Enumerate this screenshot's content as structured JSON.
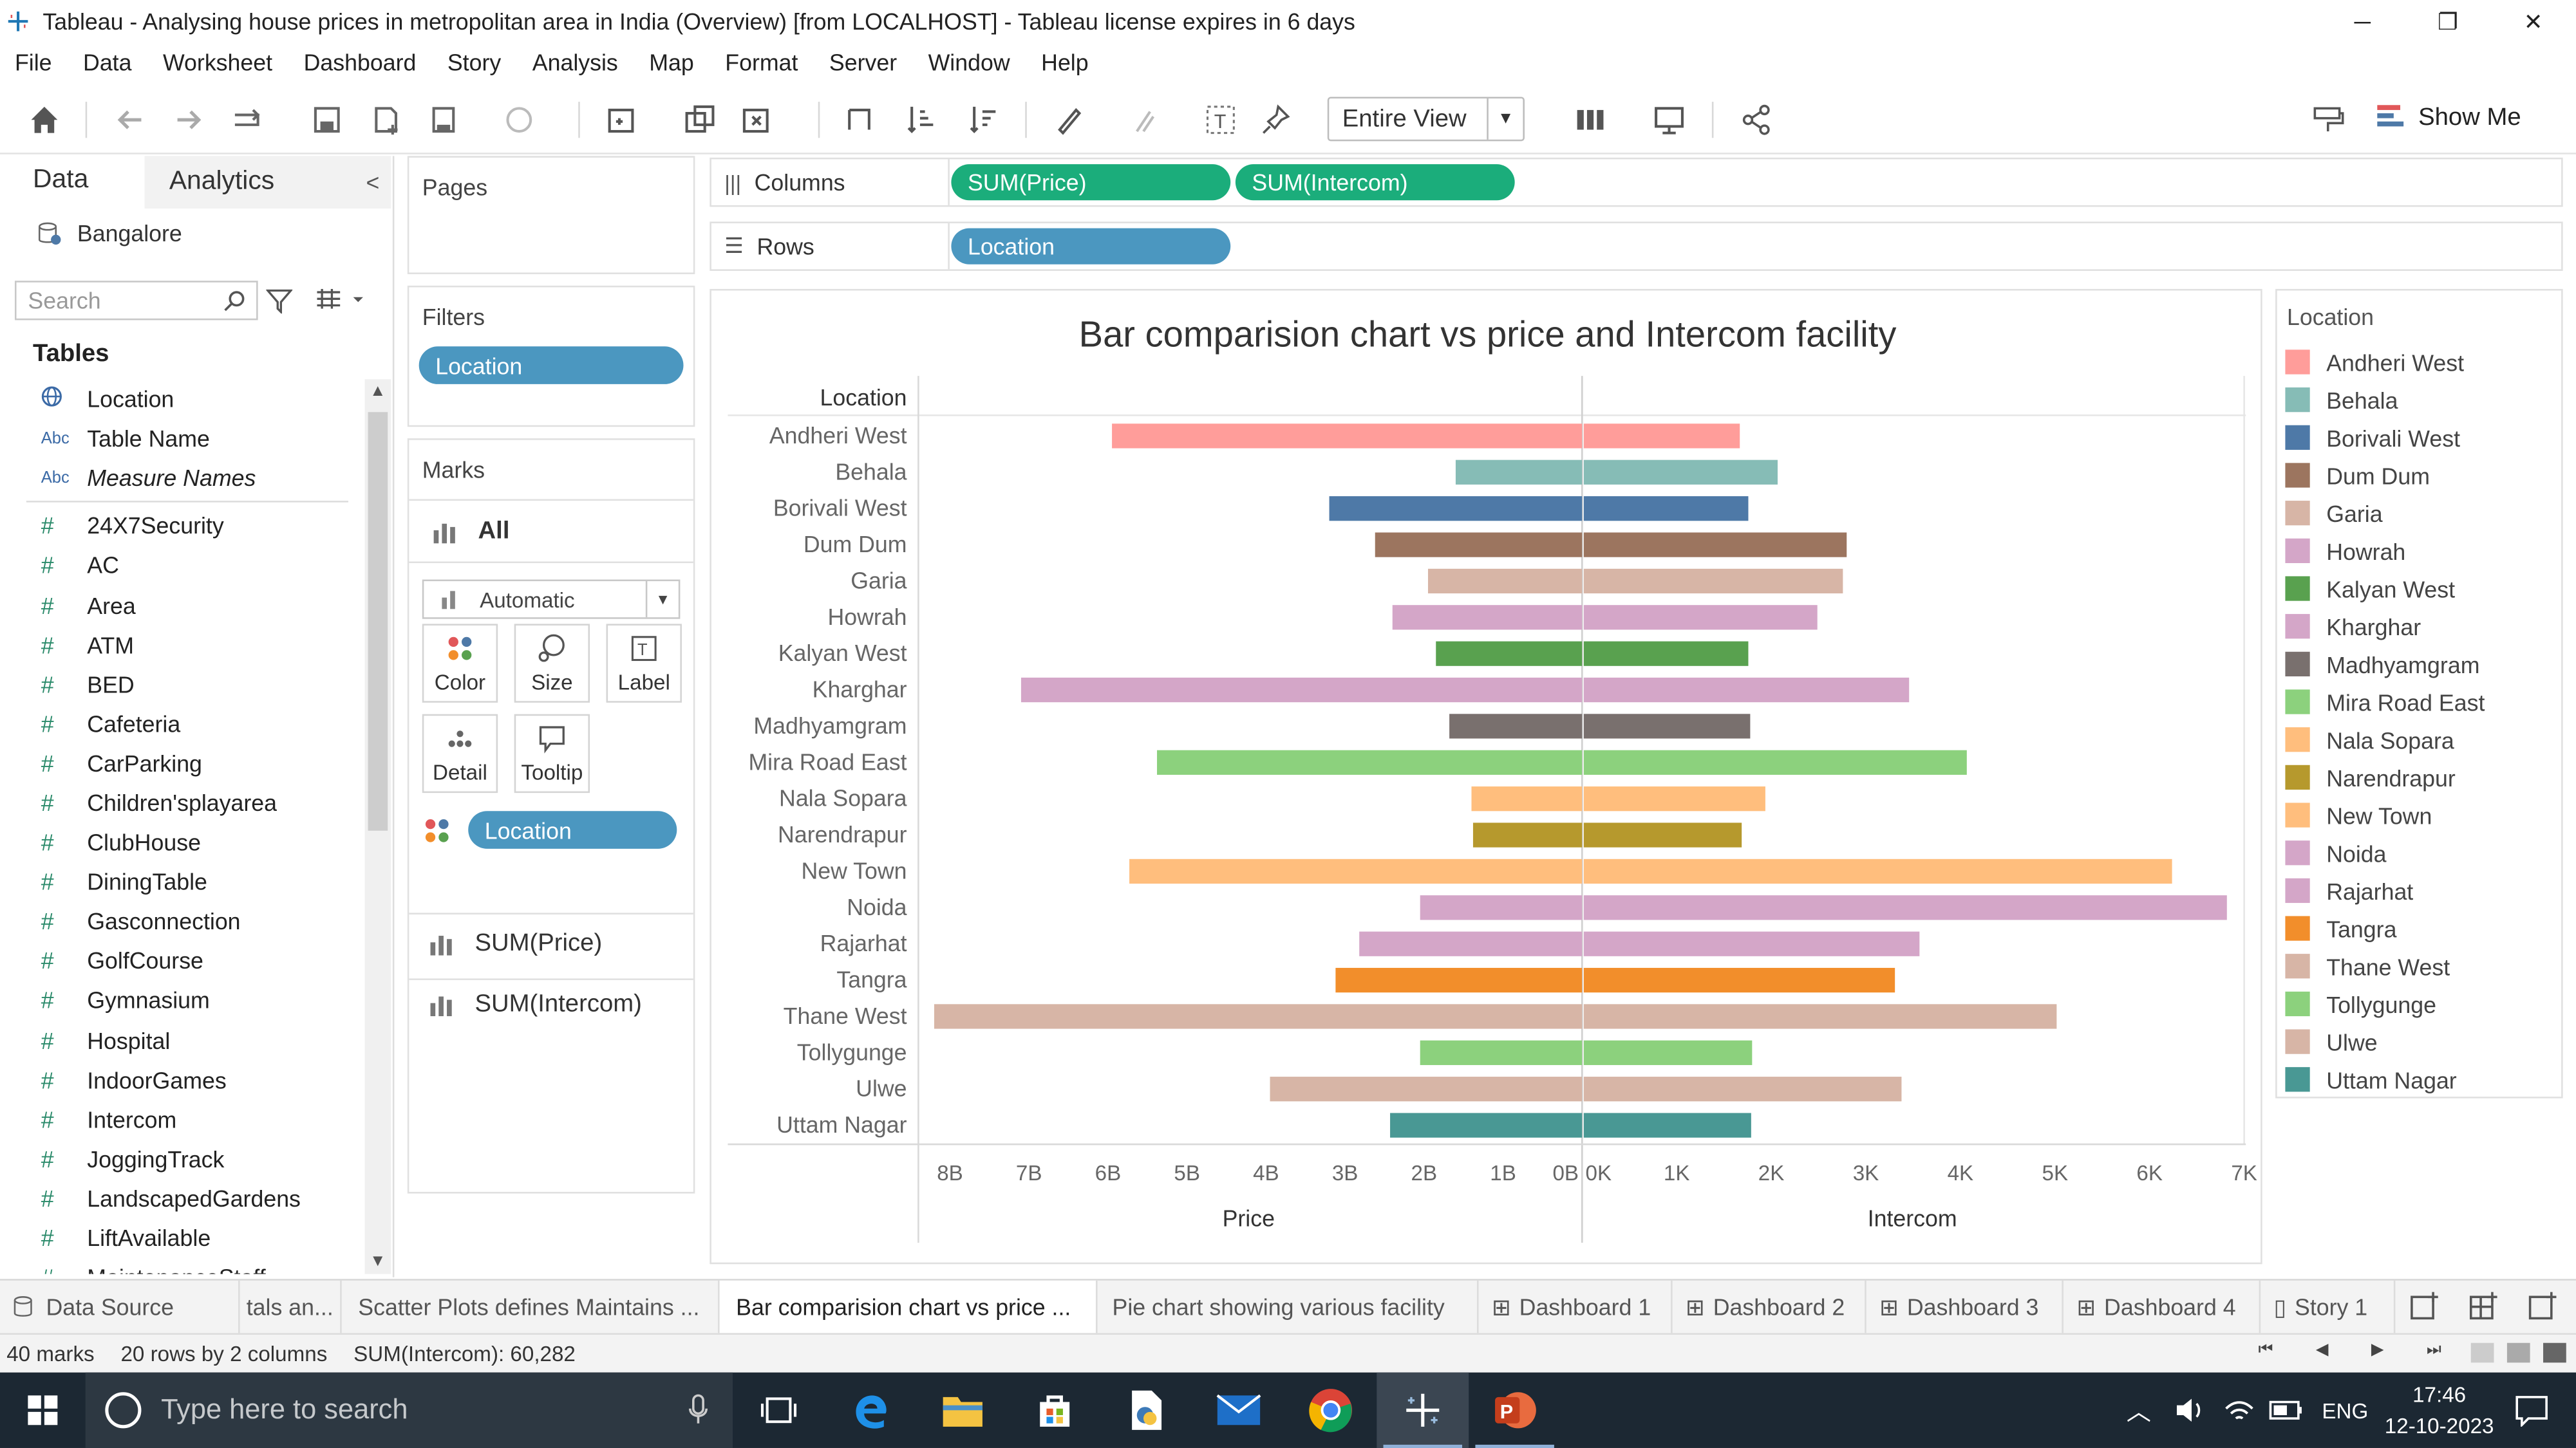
{
  "window": {
    "title": "Tableau - Analysing house prices in metropolitan area in India (Overview) [from LOCALHOST] - Tableau license expires in 6 days",
    "minimize": "─",
    "restore": "❐",
    "close": "✕"
  },
  "menu": [
    "File",
    "Data",
    "Worksheet",
    "Dashboard",
    "Story",
    "Analysis",
    "Map",
    "Format",
    "Server",
    "Window",
    "Help"
  ],
  "toolbar": {
    "view_select": "Entire View",
    "show_me": "Show Me"
  },
  "data_pane": {
    "tab_data": "Data",
    "tab_analytics": "Analytics",
    "collapse": "<",
    "source": "Bangalore",
    "search_placeholder": "Search",
    "tables_heading": "Tables",
    "fields": [
      {
        "type": "geo",
        "name": "Location"
      },
      {
        "type": "Abc",
        "name": "Table Name"
      },
      {
        "type": "Abc",
        "name": "Measure Names",
        "italic": true
      },
      {
        "type": "#",
        "name": "24X7Security"
      },
      {
        "type": "#",
        "name": "AC"
      },
      {
        "type": "#",
        "name": "Area"
      },
      {
        "type": "#",
        "name": "ATM"
      },
      {
        "type": "#",
        "name": "BED"
      },
      {
        "type": "#",
        "name": "Cafeteria"
      },
      {
        "type": "#",
        "name": "CarParking"
      },
      {
        "type": "#",
        "name": "Children'splayarea"
      },
      {
        "type": "#",
        "name": "ClubHouse"
      },
      {
        "type": "#",
        "name": "DiningTable"
      },
      {
        "type": "#",
        "name": "Gasconnection"
      },
      {
        "type": "#",
        "name": "GolfCourse"
      },
      {
        "type": "#",
        "name": "Gymnasium"
      },
      {
        "type": "#",
        "name": "Hospital"
      },
      {
        "type": "#",
        "name": "IndoorGames"
      },
      {
        "type": "#",
        "name": "Intercom"
      },
      {
        "type": "#",
        "name": "JoggingTrack"
      },
      {
        "type": "#",
        "name": "LandscapedGardens"
      },
      {
        "type": "#",
        "name": "LiftAvailable"
      },
      {
        "type": "#",
        "name": "MaintenanceStaff"
      }
    ]
  },
  "cards": {
    "pages": "Pages",
    "filters": "Filters",
    "filter_pill": "Location",
    "marks": "Marks",
    "marks_all": "All",
    "mark_type": "Automatic",
    "buttons": [
      "Color",
      "Size",
      "Label",
      "Detail",
      "Tooltip"
    ],
    "color_pill": "Location",
    "measures": [
      "SUM(Price)",
      "SUM(Intercom)"
    ]
  },
  "shelves": {
    "columns_label": "Columns",
    "rows_label": "Rows",
    "columns_pills": [
      "SUM(Price)",
      "SUM(Intercom)"
    ],
    "rows_pills": [
      "Location"
    ]
  },
  "chart_data": {
    "type": "bar",
    "title": "Bar comparision chart vs price and Intercom facility",
    "row_header": "Location",
    "categories": [
      "Andheri West",
      "Behala",
      "Borivali West",
      "Dum Dum",
      "Garia",
      "Howrah",
      "Kalyan West",
      "Kharghar",
      "Madhyamgram",
      "Mira Road East",
      "Nala Sopara",
      "Narendrapur",
      "New Town",
      "Noida",
      "Rajarhat",
      "Tangra",
      "Thane West",
      "Tollygunge",
      "Ulwe",
      "Uttam Nagar"
    ],
    "colors": [
      "#ff9d9a",
      "#86bcb6",
      "#4e79a7",
      "#9c755f",
      "#d7b5a6",
      "#d4a6c8",
      "#59a14f",
      "#d4a6c8",
      "#79706e",
      "#8cd17d",
      "#ffbe7d",
      "#b6992d",
      "#ffbe7d",
      "#d4a6c8",
      "#d4a6c8",
      "#f28e2b",
      "#d7b5a6",
      "#8cd17d",
      "#d7b5a6",
      "#499894"
    ],
    "series": [
      {
        "name": "Price",
        "values": [
          5.95,
          1.6,
          3.2,
          2.62,
          1.95,
          2.4,
          1.85,
          7.1,
          1.68,
          5.38,
          1.4,
          1.38,
          5.73,
          2.05,
          2.82,
          3.12,
          8.2,
          2.05,
          3.95,
          2.43
        ]
      },
      {
        "name": "Intercom",
        "values": [
          1650,
          2050,
          1740,
          2780,
          2740,
          2470,
          1740,
          3440,
          1760,
          4050,
          1920,
          1670,
          6220,
          6800,
          3550,
          3290,
          5000,
          1780,
          3360,
          1770
        ]
      }
    ],
    "price_axis": {
      "label": "Price",
      "ticks": [
        "8B",
        "7B",
        "6B",
        "5B",
        "4B",
        "3B",
        "2B",
        "1B",
        "0B"
      ],
      "range": [
        0,
        8.4
      ]
    },
    "intercom_axis": {
      "label": "Intercom",
      "ticks": [
        "0K",
        "1K",
        "2K",
        "3K",
        "4K",
        "5K",
        "6K",
        "7K"
      ],
      "range": [
        0,
        7000
      ]
    }
  },
  "legend": {
    "title": "Location",
    "items": [
      "Andheri West",
      "Behala",
      "Borivali West",
      "Dum Dum",
      "Garia",
      "Howrah",
      "Kalyan West",
      "Kharghar",
      "Madhyamgram",
      "Mira Road East",
      "Nala Sopara",
      "Narendrapur",
      "New Town",
      "Noida",
      "Rajarhat",
      "Tangra",
      "Thane West",
      "Tollygunge",
      "Ulwe",
      "Uttam Nagar"
    ]
  },
  "sheet_tabs": {
    "data_source": "Data Source",
    "tabs": [
      "tals an...",
      "Scatter Plots defines Maintains ...",
      "Bar comparision chart vs price ...",
      "Pie chart showing various facility",
      "Dashboard 1",
      "Dashboard 2",
      "Dashboard 3",
      "Dashboard 4",
      "Story 1"
    ],
    "active_index": 2
  },
  "status": {
    "marks": "40 marks",
    "rows": "20 rows by 2 columns",
    "sum": "SUM(Intercom): 60,282"
  },
  "taskbar": {
    "search_placeholder": "Type here to search",
    "lang": "ENG",
    "time": "17:46",
    "date": "12-10-2023"
  }
}
